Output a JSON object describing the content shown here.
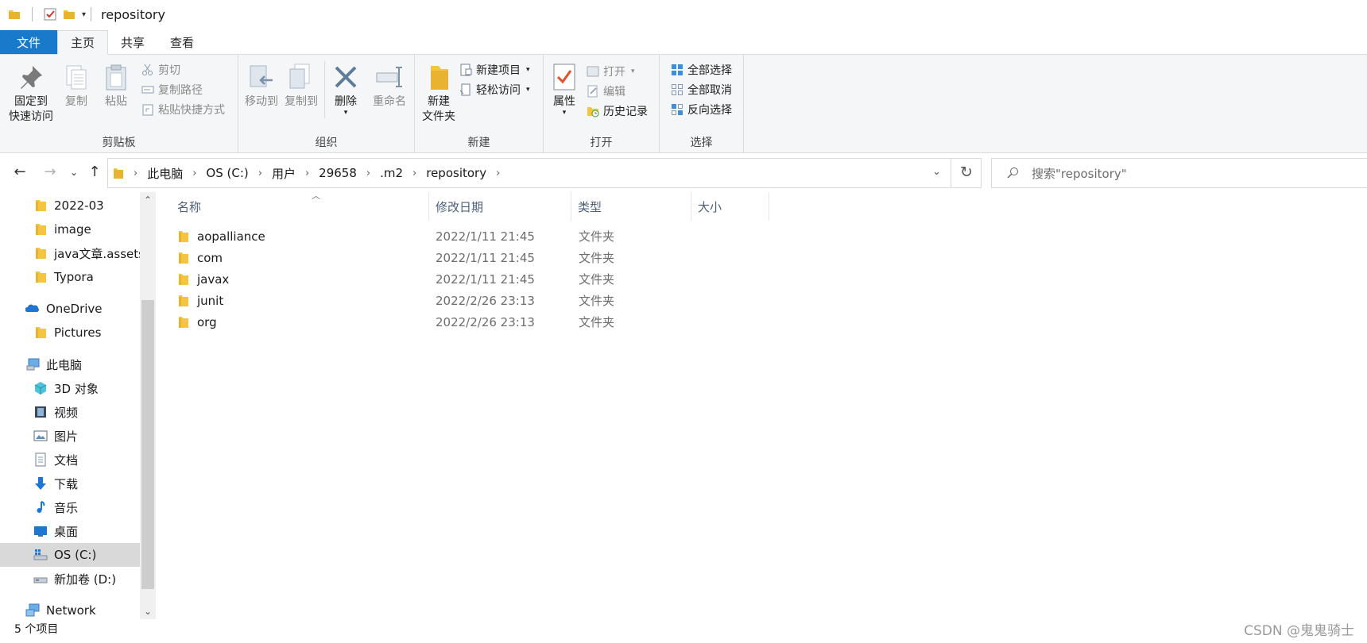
{
  "window": {
    "title": "repository"
  },
  "tabs": {
    "file": "文件",
    "home": "主页",
    "share": "共享",
    "view": "查看"
  },
  "ribbon": {
    "clipboard": {
      "label": "剪贴板",
      "pin_line1": "固定到",
      "pin_line2": "快速访问",
      "copy": "复制",
      "paste": "粘贴",
      "cut": "剪切",
      "copy_path": "复制路径",
      "paste_shortcut": "粘贴快捷方式"
    },
    "organize": {
      "label": "组织",
      "move_to": "移动到",
      "copy_to": "复制到",
      "delete": "删除",
      "rename": "重命名"
    },
    "new": {
      "label": "新建",
      "new_folder_line1": "新建",
      "new_folder_line2": "文件夹",
      "new_item": "新建项目",
      "easy_access": "轻松访问"
    },
    "open": {
      "label": "打开",
      "properties": "属性",
      "open": "打开",
      "edit": "编辑",
      "history": "历史记录"
    },
    "select": {
      "label": "选择",
      "select_all": "全部选择",
      "select_none": "全部取消",
      "invert": "反向选择"
    }
  },
  "address": {
    "crumbs": [
      "此电脑",
      "OS (C:)",
      "用户",
      "29658",
      ".m2",
      "repository"
    ]
  },
  "search": {
    "placeholder": "搜索\"repository\""
  },
  "nav_pane": {
    "items": [
      {
        "label": "2022-03",
        "icon": "folder-icon"
      },
      {
        "label": "image",
        "icon": "folder-icon"
      },
      {
        "label": "java文章.assets",
        "icon": "folder-icon"
      },
      {
        "label": "Typora",
        "icon": "folder-icon"
      },
      {
        "label": "OneDrive",
        "icon": "onedrive-icon"
      },
      {
        "label": "Pictures",
        "icon": "folder-icon"
      },
      {
        "label": "此电脑",
        "icon": "this-pc-icon"
      },
      {
        "label": "3D 对象",
        "icon": "3d-objects-icon"
      },
      {
        "label": "视频",
        "icon": "videos-icon"
      },
      {
        "label": "图片",
        "icon": "pictures-icon"
      },
      {
        "label": "文档",
        "icon": "documents-icon"
      },
      {
        "label": "下载",
        "icon": "downloads-icon"
      },
      {
        "label": "音乐",
        "icon": "music-icon"
      },
      {
        "label": "桌面",
        "icon": "desktop-icon"
      },
      {
        "label": "OS (C:)",
        "icon": "drive-c-icon"
      },
      {
        "label": "新加卷 (D:)",
        "icon": "drive-d-icon"
      },
      {
        "label": "Network",
        "icon": "network-icon"
      }
    ]
  },
  "columns": {
    "name": "名称",
    "date": "修改日期",
    "type": "类型",
    "size": "大小"
  },
  "files": [
    {
      "name": "aopalliance",
      "date": "2022/1/11 21:45",
      "type": "文件夹"
    },
    {
      "name": "com",
      "date": "2022/1/11 21:45",
      "type": "文件夹"
    },
    {
      "name": "javax",
      "date": "2022/1/11 21:45",
      "type": "文件夹"
    },
    {
      "name": "junit",
      "date": "2022/2/26 23:13",
      "type": "文件夹"
    },
    {
      "name": "org",
      "date": "2022/2/26 23:13",
      "type": "文件夹"
    }
  ],
  "status": {
    "count": "5 个项目"
  },
  "watermark": "CSDN @鬼鬼骑士",
  "colors": {
    "accent": "#1979ca",
    "folder": "#f5c542",
    "ribbon_bg": "#f5f6f7",
    "selected_bg": "#d9d9d9"
  }
}
